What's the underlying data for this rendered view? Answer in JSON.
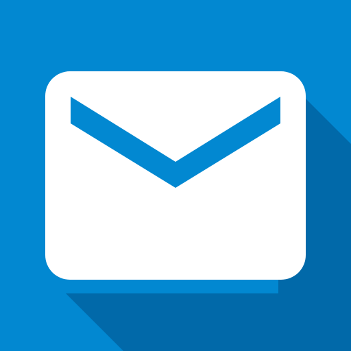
{
  "icon": {
    "name": "mail-envelope-icon",
    "colors": {
      "background": "#0288d1",
      "long_shadow": "#0167a6",
      "envelope_body": "#ffffff",
      "envelope_flap": "#0288d1"
    }
  }
}
